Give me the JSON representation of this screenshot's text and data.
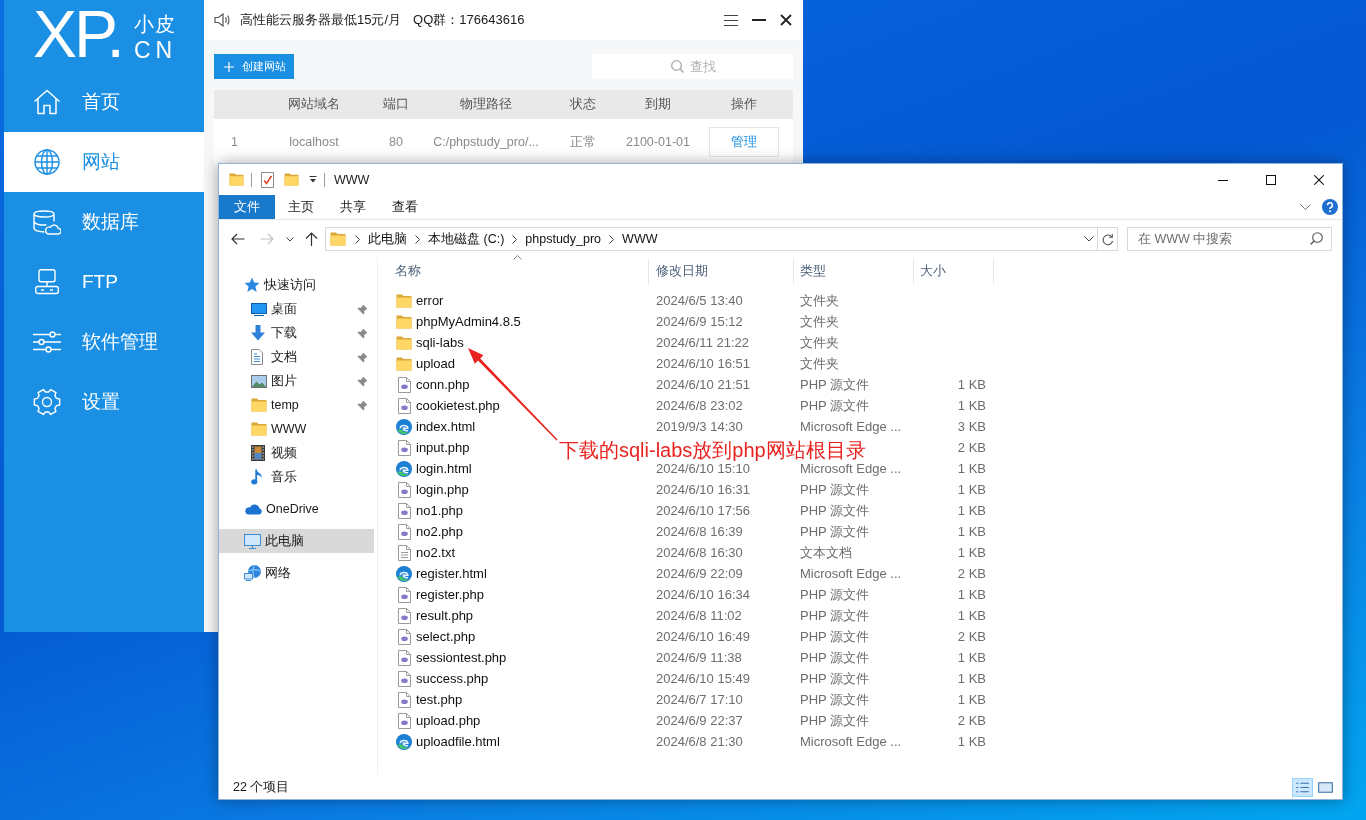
{
  "phpstudy": {
    "logo": {
      "mark": "XP.",
      "name": "小皮",
      "domain": "CN"
    },
    "nav": [
      {
        "label": "首页",
        "selected": false
      },
      {
        "label": "网站",
        "selected": true
      },
      {
        "label": "数据库",
        "selected": false
      },
      {
        "label": "FTP",
        "selected": false
      },
      {
        "label": "软件管理",
        "selected": false
      },
      {
        "label": "设置",
        "selected": false
      }
    ],
    "notice": {
      "promo": "高性能云服务器最低15元/月",
      "qq_group": "QQ群：176643616"
    },
    "create_button": "创建网站",
    "search": {
      "placeholder": "查找"
    },
    "table": {
      "columns": [
        "网站域名",
        "端口",
        "物理路径",
        "状态",
        "到期",
        "操作"
      ],
      "rows": [
        {
          "index": "1",
          "domain": "localhost",
          "port": "80",
          "path": "C:/phpstudy_pro/...",
          "status": "正常",
          "expires": "2100-01-01",
          "action": "管理"
        }
      ]
    }
  },
  "explorer": {
    "title": "WWW",
    "ribbon": {
      "file_menu": "文件",
      "tabs": [
        "主页",
        "共享",
        "查看"
      ]
    },
    "history": {
      "back": {
        "disabled": false
      },
      "forward": {
        "disabled": true
      }
    },
    "address": {
      "crumbs": [
        "此电脑",
        "本地磁盘 (C:)",
        "phpstudy_pro",
        "WWW"
      ]
    },
    "search": {
      "placeholder": "在 WWW 中搜索"
    },
    "navigation": [
      {
        "label": "快速访问",
        "kind": "quick_access",
        "selected": false,
        "children": [
          {
            "label": "桌面",
            "kind": "desktop",
            "pinned": true,
            "selected": false
          },
          {
            "label": "下载",
            "kind": "downloads",
            "pinned": true,
            "selected": false
          },
          {
            "label": "文档",
            "kind": "documents",
            "pinned": true,
            "selected": false
          },
          {
            "label": "图片",
            "kind": "pictures",
            "pinned": true,
            "selected": false
          },
          {
            "label": "temp",
            "kind": "folder",
            "pinned": true,
            "selected": false
          },
          {
            "label": "WWW",
            "kind": "folder",
            "pinned": false,
            "selected": false
          },
          {
            "label": "视频",
            "kind": "videos",
            "pinned": false,
            "selected": false
          },
          {
            "label": "音乐",
            "kind": "music",
            "pinned": false,
            "selected": false
          }
        ]
      },
      {
        "label": "OneDrive",
        "kind": "onedrive",
        "selected": false
      },
      {
        "label": "此电脑",
        "kind": "this_pc",
        "selected": true
      },
      {
        "label": "网络",
        "kind": "network",
        "selected": false
      }
    ],
    "columns": [
      {
        "label": "名称",
        "sorted": true
      },
      {
        "label": "修改日期",
        "sorted": false
      },
      {
        "label": "类型",
        "sorted": false
      },
      {
        "label": "大小",
        "sorted": false
      }
    ],
    "files": [
      {
        "name": "error",
        "kind": "folder",
        "modified": "2024/6/5 13:40",
        "type": "文件夹"
      },
      {
        "name": "phpMyAdmin4.8.5",
        "kind": "folder",
        "modified": "2024/6/9 15:12",
        "type": "文件夹"
      },
      {
        "name": "sqli-labs",
        "kind": "folder",
        "modified": "2024/6/11 21:22",
        "type": "文件夹"
      },
      {
        "name": "upload",
        "kind": "folder",
        "modified": "2024/6/10 16:51",
        "type": "文件夹"
      },
      {
        "name": "conn.php",
        "kind": "php",
        "modified": "2024/6/10 21:51",
        "type": "PHP 源文件",
        "size": "1 KB"
      },
      {
        "name": "cookietest.php",
        "kind": "php",
        "modified": "2024/6/8 23:02",
        "type": "PHP 源文件",
        "size": "1 KB"
      },
      {
        "name": "index.html",
        "kind": "html",
        "modified": "2019/9/3 14:30",
        "type": "Microsoft Edge ...",
        "size": "3 KB"
      },
      {
        "name": "input.php",
        "kind": "php",
        "size": "2 KB"
      },
      {
        "name": "login.html",
        "kind": "html",
        "modified": "2024/6/10 15:10",
        "type": "Microsoft Edge ...",
        "size": "1 KB"
      },
      {
        "name": "login.php",
        "kind": "php",
        "modified": "2024/6/10 16:31",
        "type": "PHP 源文件",
        "size": "1 KB"
      },
      {
        "name": "no1.php",
        "kind": "php",
        "modified": "2024/6/10 17:56",
        "type": "PHP 源文件",
        "size": "1 KB"
      },
      {
        "name": "no2.php",
        "kind": "php",
        "modified": "2024/6/8 16:39",
        "type": "PHP 源文件",
        "size": "1 KB"
      },
      {
        "name": "no2.txt",
        "kind": "text",
        "modified": "2024/6/8 16:30",
        "type": "文本文档",
        "size": "1 KB"
      },
      {
        "name": "register.html",
        "kind": "html",
        "modified": "2024/6/9 22:09",
        "type": "Microsoft Edge ...",
        "size": "2 KB"
      },
      {
        "name": "register.php",
        "kind": "php",
        "modified": "2024/6/10 16:34",
        "type": "PHP 源文件",
        "size": "1 KB"
      },
      {
        "name": "result.php",
        "kind": "php",
        "modified": "2024/6/8 11:02",
        "type": "PHP 源文件",
        "size": "1 KB"
      },
      {
        "name": "select.php",
        "kind": "php",
        "modified": "2024/6/10 16:49",
        "type": "PHP 源文件",
        "size": "2 KB"
      },
      {
        "name": "sessiontest.php",
        "kind": "php",
        "modified": "2024/6/9 11:38",
        "type": "PHP 源文件",
        "size": "1 KB"
      },
      {
        "name": "success.php",
        "kind": "php",
        "modified": "2024/6/10 15:49",
        "type": "PHP 源文件",
        "size": "1 KB"
      },
      {
        "name": "test.php",
        "kind": "php",
        "modified": "2024/6/7 17:10",
        "type": "PHP 源文件",
        "size": "1 KB"
      },
      {
        "name": "upload.php",
        "kind": "php",
        "modified": "2024/6/9 22:37",
        "type": "PHP 源文件",
        "size": "2 KB"
      },
      {
        "name": "uploadfile.html",
        "kind": "html",
        "modified": "2024/6/8 21:30",
        "type": "Microsoft Edge ...",
        "size": "1 KB"
      }
    ],
    "status": "22 个项目",
    "views": [
      {
        "kind": "details",
        "selected": true
      },
      {
        "kind": "large_icons",
        "selected": false
      }
    ]
  },
  "annotation": {
    "text": "下载的sqli-labs放到php网站根目录"
  }
}
